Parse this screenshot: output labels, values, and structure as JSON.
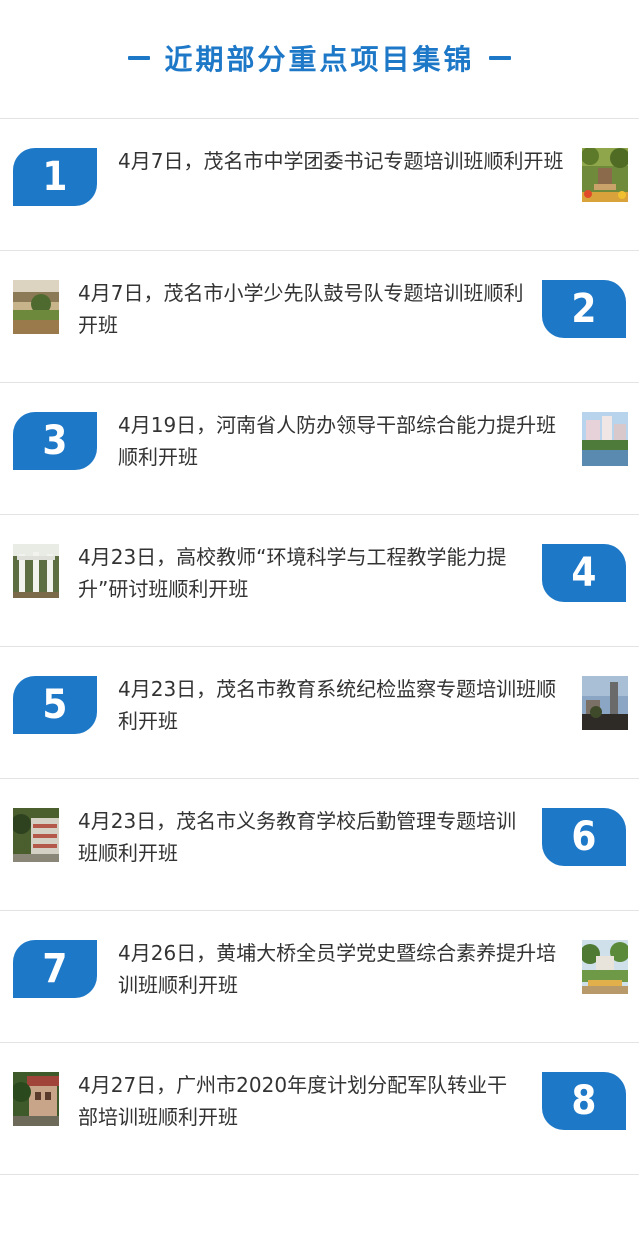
{
  "header": {
    "title": "近期部分重点项目集锦"
  },
  "items": [
    {
      "number": "1",
      "text": "4月7日，茂名市中学团委书记专题培训班顺利开班"
    },
    {
      "number": "2",
      "text": "4月7日，茂名市小学少先队鼓号队专题培训班顺利开班"
    },
    {
      "number": "3",
      "text": "4月19日，河南省人防办领导干部综合能力提升班顺利开班"
    },
    {
      "number": "4",
      "text": "4月23日，高校教师“环境科学与工程教学能力提升”研讨班顺利开班"
    },
    {
      "number": "5",
      "text": "4月23日，茂名市教育系统纪检监察专题培训班顺利开班"
    },
    {
      "number": "6",
      "text": "4月23日，茂名市义务教育学校后勤管理专题培训班顺利开班"
    },
    {
      "number": "7",
      "text": "4月26日，黄埔大桥全员学党史暨综合素养提升培训班顺利开班"
    },
    {
      "number": "8",
      "text": "4月27日，广州市2020年度计划分配军队转业干部培训班顺利开班"
    }
  ],
  "colors": {
    "accent": "#1e78c8",
    "text": "#333333",
    "divider": "#e3e3e3"
  }
}
